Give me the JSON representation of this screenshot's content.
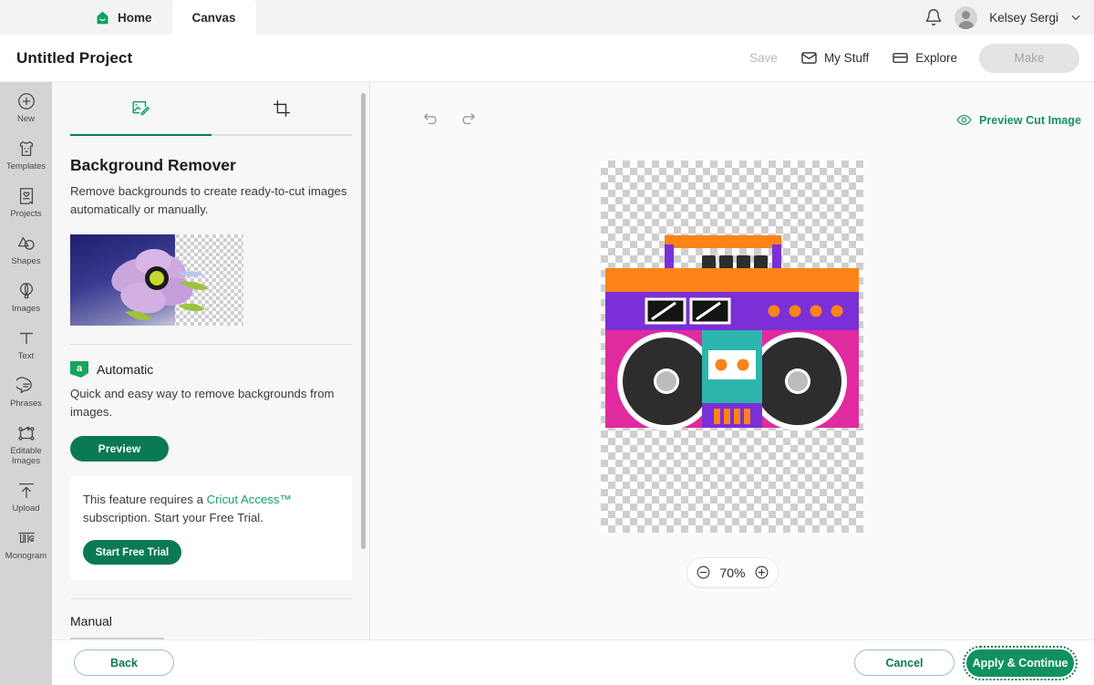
{
  "topbar": {
    "tabs": [
      {
        "label": "Home",
        "icon": "home-icon",
        "active": false
      },
      {
        "label": "Canvas",
        "icon": "",
        "active": true
      }
    ],
    "bell_icon": "notification-bell-icon",
    "avatar_icon": "user-avatar",
    "username": "Kelsey Sergi",
    "caret_icon": "chevron-down-icon"
  },
  "header": {
    "project_title": "Untitled Project",
    "save_label": "Save",
    "my_stuff_label": "My Stuff",
    "my_stuff_icon": "envelope-icon",
    "explore_label": "Explore",
    "explore_icon": "card-icon",
    "make_label": "Make"
  },
  "rail": {
    "items": [
      {
        "label": "New",
        "icon": "plus-circle-icon"
      },
      {
        "label": "Templates",
        "icon": "tshirt-icon"
      },
      {
        "label": "Projects",
        "icon": "project-card-icon"
      },
      {
        "label": "Shapes",
        "icon": "shapes-icon"
      },
      {
        "label": "Images",
        "icon": "hot-air-balloon-icon"
      },
      {
        "label": "Text",
        "icon": "text-t-icon"
      },
      {
        "label": "Phrases",
        "icon": "speech-bubble-icon"
      },
      {
        "label": "Editable Images",
        "icon": "editable-images-icon"
      },
      {
        "label": "Upload",
        "icon": "upload-arrow-icon"
      },
      {
        "label": "Monogram",
        "icon": "monogram-icon"
      }
    ]
  },
  "panel": {
    "tabs": [
      {
        "name": "edit-image-tab",
        "icon": "image-edit-icon",
        "active": true
      },
      {
        "name": "crop-tab",
        "icon": "crop-icon",
        "active": false
      }
    ],
    "title": "Background Remover",
    "description": "Remove backgrounds to create ready-to-cut images automatically or manually.",
    "preview_image": "flower-before-after-thumbnail",
    "automatic": {
      "badge_letter": "a",
      "badge_icon": "automatic-tag-icon",
      "title": "Automatic",
      "description": "Quick and easy way to remove backgrounds from images.",
      "preview_button": "Preview"
    },
    "access_card": {
      "text_before": "This feature requires a ",
      "link": "Cricut Access™",
      "text_after": " subscription. Start your Free Trial.",
      "trial_button": "Start Free Trial"
    },
    "manual": {
      "title": "Manual",
      "tools": [
        {
          "name": "magic-wand-tool",
          "icon": "magic-wand-icon",
          "selected": true
        },
        {
          "name": "eraser-tool",
          "icon": "eraser-icon",
          "selected": false
        },
        {
          "name": "restore-tool",
          "icon": "undo-restore-icon",
          "selected": false
        }
      ]
    },
    "scrollbar": "panel-scrollbar"
  },
  "canvas": {
    "undo_icon": "undo-icon",
    "redo_icon": "redo-icon",
    "preview_cut_label": "Preview Cut Image",
    "preview_cut_icon": "eye-icon",
    "artwork": "boombox-clipart-on-transparent-background",
    "zoom": {
      "minus_icon": "zoom-out-icon",
      "level": "70%",
      "plus_icon": "zoom-in-icon"
    }
  },
  "bottombar": {
    "back_label": "Back",
    "cancel_label": "Cancel",
    "apply_label": "Apply & Continue"
  },
  "colors": {
    "brand_green": "#0b7a52",
    "link_green": "#1aa06d",
    "rail_bg": "#d4d4d4",
    "panel_bg": "#f7f7f7",
    "canvas_bg": "#fafafa"
  }
}
